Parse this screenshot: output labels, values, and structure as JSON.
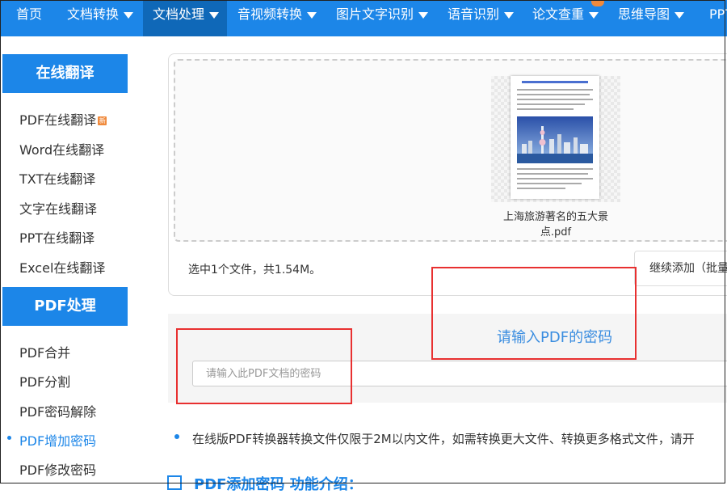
{
  "nav": {
    "items": [
      {
        "label": "首页",
        "dropdown": false,
        "active": false
      },
      {
        "label": "文档转换",
        "dropdown": true,
        "active": false
      },
      {
        "label": "文档处理",
        "dropdown": true,
        "active": true
      },
      {
        "label": "音视频转换",
        "dropdown": true,
        "active": false
      },
      {
        "label": "图片文字识别",
        "dropdown": true,
        "active": false
      },
      {
        "label": "语音识别",
        "dropdown": true,
        "active": false
      },
      {
        "label": "论文查重",
        "dropdown": true,
        "active": false
      },
      {
        "label": "思维导图",
        "dropdown": true,
        "active": false
      },
      {
        "label": "PPT",
        "dropdown": false,
        "active": false
      }
    ]
  },
  "sidebar": {
    "sections": [
      {
        "title": "在线翻译",
        "items": [
          {
            "label": "PDF在线翻译",
            "badge": "新"
          },
          {
            "label": "Word在线翻译"
          },
          {
            "label": "TXT在线翻译"
          },
          {
            "label": "文字在线翻译"
          },
          {
            "label": "PPT在线翻译"
          },
          {
            "label": "Excel在线翻译"
          }
        ]
      },
      {
        "title": "PDF处理",
        "items": [
          {
            "label": "PDF合并"
          },
          {
            "label": "PDF分割"
          },
          {
            "label": "PDF密码解除"
          },
          {
            "label": "PDF增加密码",
            "current": true
          },
          {
            "label": "PDF修改密码"
          }
        ]
      }
    ]
  },
  "upload": {
    "file_name": "上海旅游著名的五大景点.pdf",
    "file_info": "选中1个文件，共1.54M。",
    "add_more_label": "继续添加（批量"
  },
  "password": {
    "title": "请输入PDF的密码",
    "placeholder": "请输入此PDF文档的密码",
    "value": ""
  },
  "notice": "在线版PDF转换器转换文件仅限于2M以内文件，如需转换更大文件、转换更多格式文件，请开",
  "intro_heading": "PDF添加密码 功能介绍：",
  "colors": {
    "brand_blue": "#1c86e8",
    "nav_active": "#0f68b8",
    "annotation_red": "#e83030",
    "badge_orange": "#f08a3c"
  }
}
